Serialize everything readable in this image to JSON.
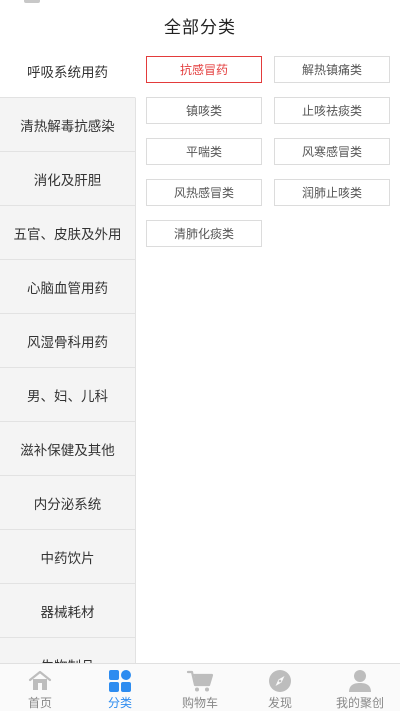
{
  "header": {
    "title": "全部分类"
  },
  "sidebar": {
    "items": [
      {
        "label": "呼吸系统用药",
        "active": true
      },
      {
        "label": "清热解毒抗感染"
      },
      {
        "label": "消化及肝胆"
      },
      {
        "label": "五官、皮肤及外用"
      },
      {
        "label": "心脑血管用药"
      },
      {
        "label": "风湿骨科用药"
      },
      {
        "label": "男、妇、儿科"
      },
      {
        "label": "滋补保健及其他"
      },
      {
        "label": "内分泌系统"
      },
      {
        "label": "中药饮片"
      },
      {
        "label": "器械耗材"
      },
      {
        "label": "生物制品"
      }
    ]
  },
  "subcategories": [
    {
      "label": "抗感冒药",
      "active": true
    },
    {
      "label": "解热镇痛类"
    },
    {
      "label": "镇咳类"
    },
    {
      "label": "止咳祛痰类"
    },
    {
      "label": "平喘类"
    },
    {
      "label": "风寒感冒类"
    },
    {
      "label": "风热感冒类"
    },
    {
      "label": "润肺止咳类"
    },
    {
      "label": "清肺化痰类"
    }
  ],
  "tabbar": {
    "items": [
      {
        "label": "首页",
        "icon": "home-icon"
      },
      {
        "label": "分类",
        "icon": "grid-icon",
        "active": true
      },
      {
        "label": "购物车",
        "icon": "cart-icon"
      },
      {
        "label": "发现",
        "icon": "compass-icon"
      },
      {
        "label": "我的聚创",
        "icon": "user-icon"
      }
    ]
  },
  "colors": {
    "accent": "#e33b3b",
    "tab_active": "#2d8cf0",
    "tab_inactive": "#bdbdbd",
    "sidebar_bg": "#f4f4f4"
  }
}
